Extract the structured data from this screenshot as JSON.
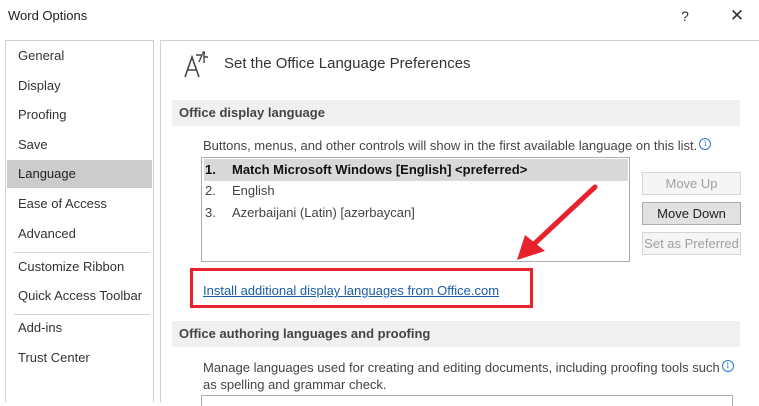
{
  "window": {
    "title": "Word Options",
    "help_label": "?",
    "close_label": "✕"
  },
  "sidebar": {
    "items": [
      {
        "label": "General"
      },
      {
        "label": "Display"
      },
      {
        "label": "Proofing"
      },
      {
        "label": "Save"
      },
      {
        "label": "Language",
        "selected": true
      },
      {
        "label": "Ease of Access"
      },
      {
        "label": "Advanced"
      },
      {
        "label": "Customize Ribbon"
      },
      {
        "label": "Quick Access Toolbar"
      },
      {
        "label": "Add-ins"
      },
      {
        "label": "Trust Center"
      }
    ]
  },
  "main": {
    "heading": "Set the Office Language Preferences",
    "display_section": {
      "title": "Office display language",
      "description": "Buttons, menus, and other controls will show in the first available language on this list.",
      "languages": [
        {
          "num": "1.",
          "name": "Match Microsoft Windows [English] <preferred>",
          "selected": true
        },
        {
          "num": "2.",
          "name": "English"
        },
        {
          "num": "3.",
          "name": "Azerbaijani (Latin) [azərbaycan]"
        }
      ],
      "buttons": {
        "move_up": "Move Up",
        "move_down": "Move Down",
        "set_preferred": "Set as Preferred"
      },
      "install_link": "Install additional display languages from Office.com"
    },
    "authoring_section": {
      "title": "Office authoring languages and proofing",
      "description_line1": "Manage languages used for creating and editing documents, including proofing tools such",
      "description_line2": "as spelling and grammar check."
    }
  },
  "colors": {
    "highlight": "#e8222d",
    "link": "#1a5ea8",
    "selected_nav": "#cccccc"
  }
}
